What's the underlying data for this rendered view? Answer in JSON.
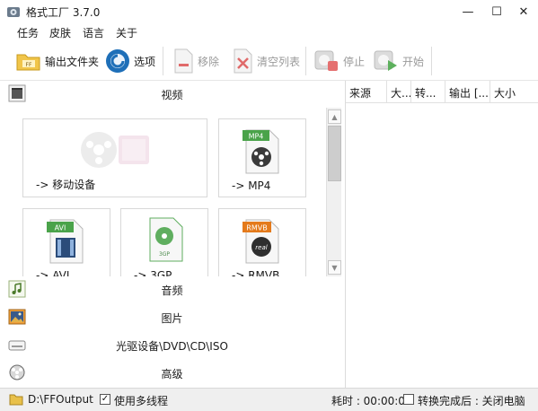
{
  "window": {
    "title": "格式工厂 3.7.0",
    "minimize_glyph": "—",
    "maximize_glyph": "☐",
    "close_glyph": "✕"
  },
  "menu": {
    "items": [
      "任务",
      "皮肤",
      "语言",
      "关于"
    ]
  },
  "toolbar": {
    "output_folder": "输出文件夹",
    "options": "选项",
    "remove": "移除",
    "clear_list": "清空列表",
    "stop": "停止",
    "start": "开始"
  },
  "categories": {
    "video": "视频",
    "audio": "音频",
    "picture": "图片",
    "rom": "光驱设备\\DVD\\CD\\ISO",
    "advanced": "高级"
  },
  "video_tiles": {
    "mobile": "-> 移动设备",
    "mp4": "-> MP4",
    "mp4_badge": "MP4",
    "avi": "-> AVI",
    "avi_badge": "AVI",
    "3gp": "-> 3GP",
    "3gp_badge": "3GP",
    "rmvb": "-> RMVB",
    "rmvb_badge": "RMVB"
  },
  "task_list": {
    "columns": [
      "来源",
      "大...",
      "转...",
      "输出 [...",
      "大小"
    ]
  },
  "statusbar": {
    "output_path": "D:\\FFOutput",
    "multithread_label": "使用多线程",
    "multithread_checked": "✓",
    "elapsed": "耗时 : 00:00:00",
    "after_convert": "转换完成后 : 关闭电脑"
  },
  "colors": {
    "accent_blue": "#1e6fb8",
    "mp4_green": "#4aa34a",
    "rmvb_orange": "#e47a1b",
    "disabled_gray": "#9a9a9a"
  }
}
